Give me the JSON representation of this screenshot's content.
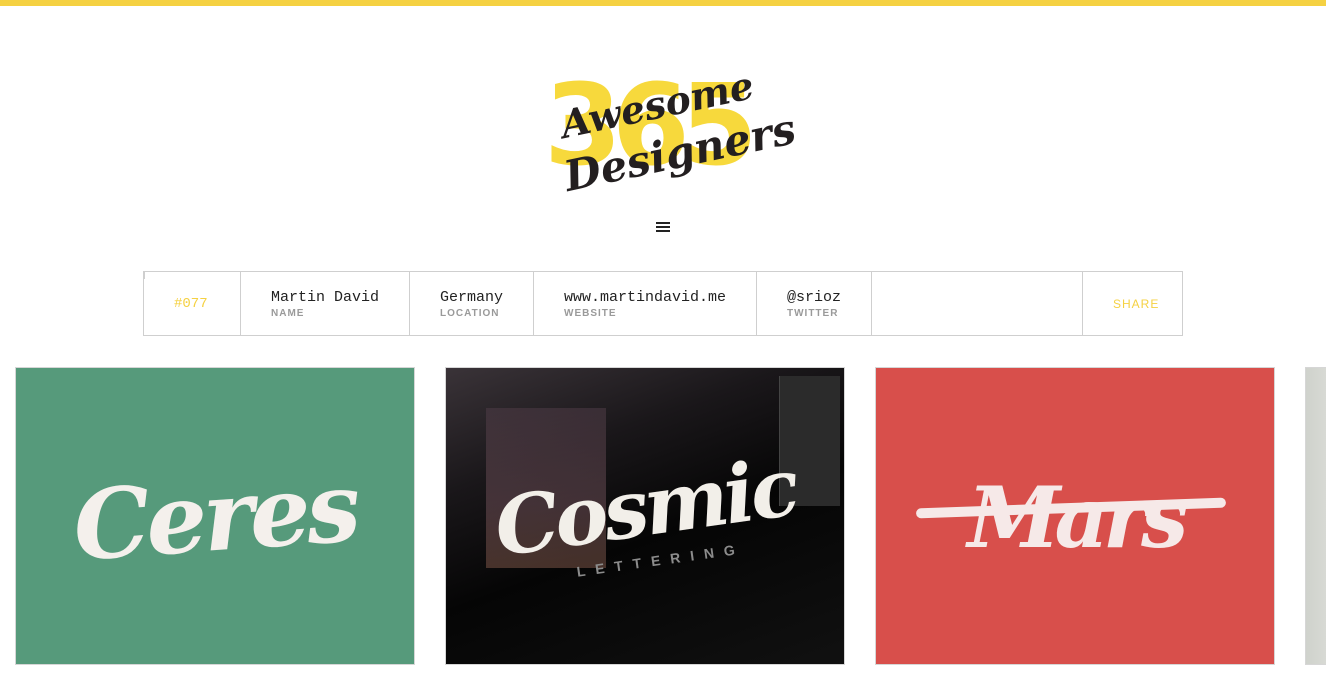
{
  "brand": {
    "logo_number": "365",
    "logo_line1": "Awesome",
    "logo_line2": "Designers",
    "accent_color": "#f5d142"
  },
  "nav": {
    "menu_icon": "hamburger-menu-icon"
  },
  "designer": {
    "number": "#077",
    "name": {
      "value": "Martin David",
      "label": "NAME"
    },
    "location": {
      "value": "Germany",
      "label": "LOCATION"
    },
    "website": {
      "value": "www.martindavid.me",
      "label": "WEBSITE"
    },
    "twitter": {
      "value": "@srioz",
      "label": "TWITTER"
    },
    "share_label": "SHARE"
  },
  "gallery": [
    {
      "title": "Ceres",
      "background": "#569a7b"
    },
    {
      "title": "Cosmic",
      "subtitle": "LETTERING",
      "background": "#0b0b0d"
    },
    {
      "title": "Mars",
      "background": "#d84f4b"
    },
    {
      "title": "",
      "background": "#dcdcd8"
    }
  ]
}
